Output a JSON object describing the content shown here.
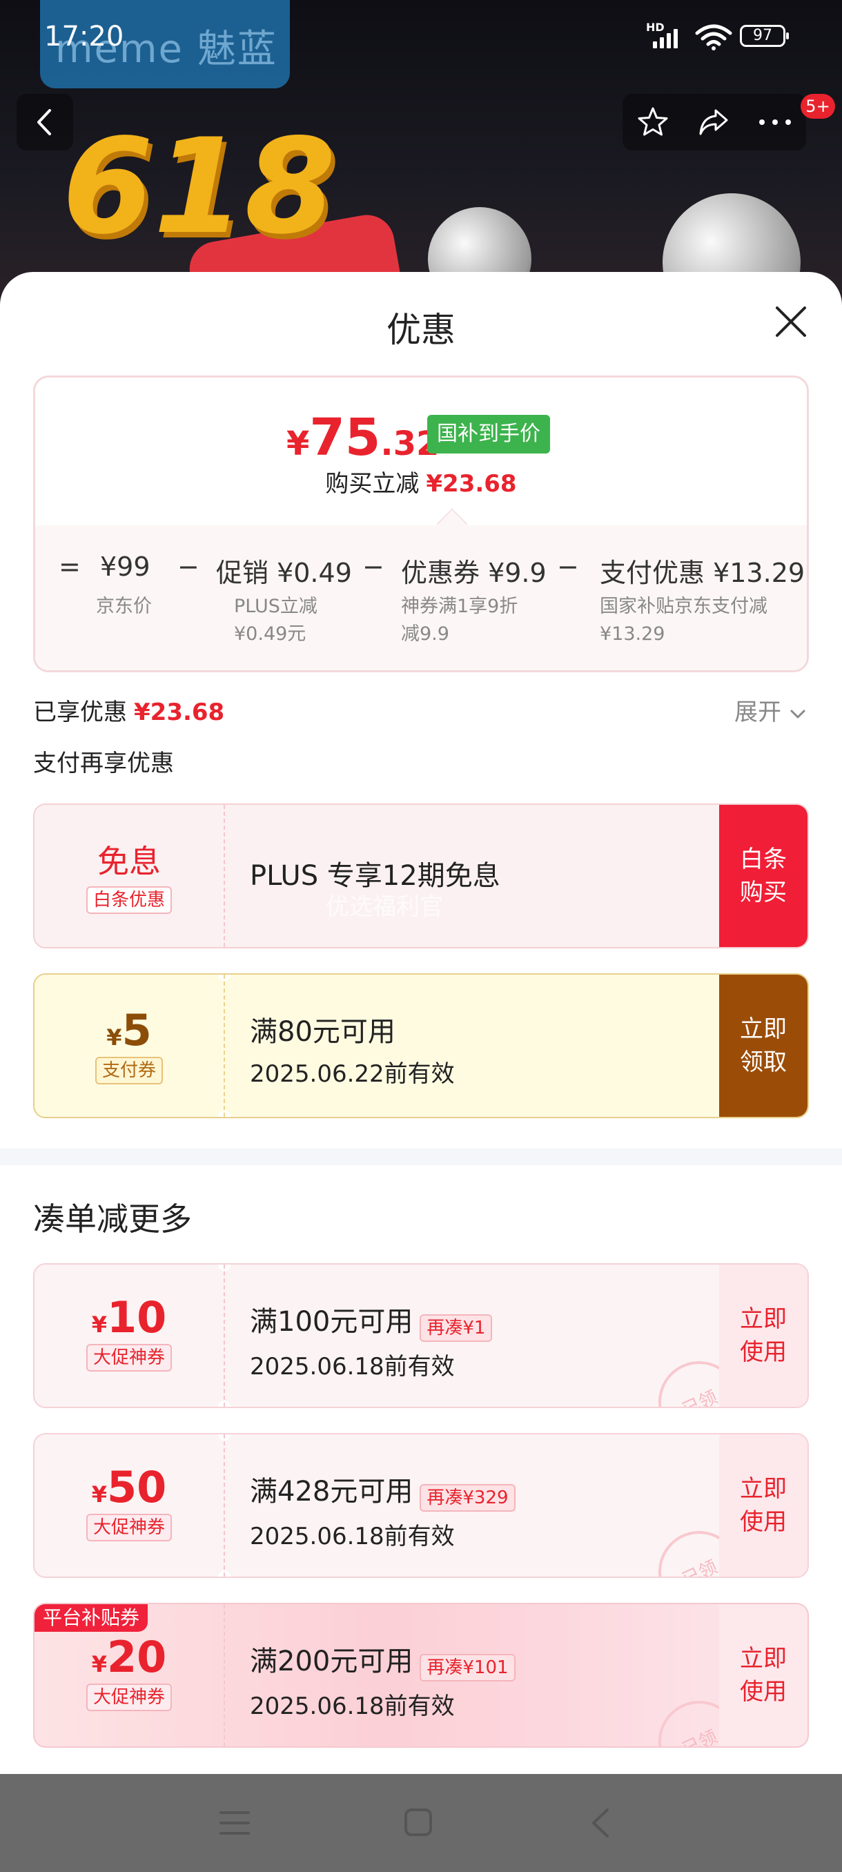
{
  "status_bar": {
    "time": "17:20",
    "network": "HD",
    "battery": "97"
  },
  "banner": {
    "brand": "meme 魅蓝",
    "big_number": "618",
    "notification_count": "5+"
  },
  "sheet": {
    "title": "优惠",
    "price_card": {
      "currency": "¥",
      "price_int": "75",
      "price_dec": ".32",
      "price_tag": "国补到手价",
      "save_label": "购买立减",
      "save_amount": "¥23.68",
      "breakdown": [
        {
          "op": "=",
          "value": "¥99",
          "sub": "京东价"
        },
        {
          "op": "−",
          "value": "促销 ¥0.49",
          "sub": "PLUS立减\n¥0.49元"
        },
        {
          "op": "−",
          "value": "优惠券 ¥9.9",
          "sub": "神券满1享9折\n减9.9"
        },
        {
          "op": "−",
          "value": "支付优惠 ¥13.29",
          "sub": "国家补贴京东支付减\n¥13.29"
        }
      ]
    },
    "enjoyed": {
      "label": "已享优惠",
      "amount": "¥23.68",
      "expand": "展开"
    },
    "pay_again_title": "支付再享优惠",
    "pay_coupons": [
      {
        "big": "免息",
        "tag": "白条优惠",
        "title": "PLUS 专享12期免息",
        "watermark": "优选福利官",
        "button": "白条\n购买"
      },
      {
        "currency": "¥",
        "big": "5",
        "tag": "支付券",
        "title": "满80元可用",
        "valid": "2025.06.22前有效",
        "button": "立即\n领取"
      }
    ],
    "more_title": "凑单减更多",
    "more_coupons": [
      {
        "currency": "¥",
        "big": "10",
        "tag": "大促神券",
        "title": "满100元可用",
        "extra": "再凑¥1",
        "valid": "2025.06.18前有效",
        "button": "立即\n使用",
        "stamp": "已领"
      },
      {
        "currency": "¥",
        "big": "50",
        "tag": "大促神券",
        "title": "满428元可用",
        "extra": "再凑¥329",
        "valid": "2025.06.18前有效",
        "button": "立即\n使用",
        "stamp": "已领"
      },
      {
        "corner": "平台补贴券",
        "currency": "¥",
        "big": "20",
        "tag": "大促神券",
        "title": "满200元可用",
        "extra": "再凑¥101",
        "valid": "2025.06.18前有效",
        "button": "立即\n使用",
        "stamp": "已领"
      }
    ]
  }
}
